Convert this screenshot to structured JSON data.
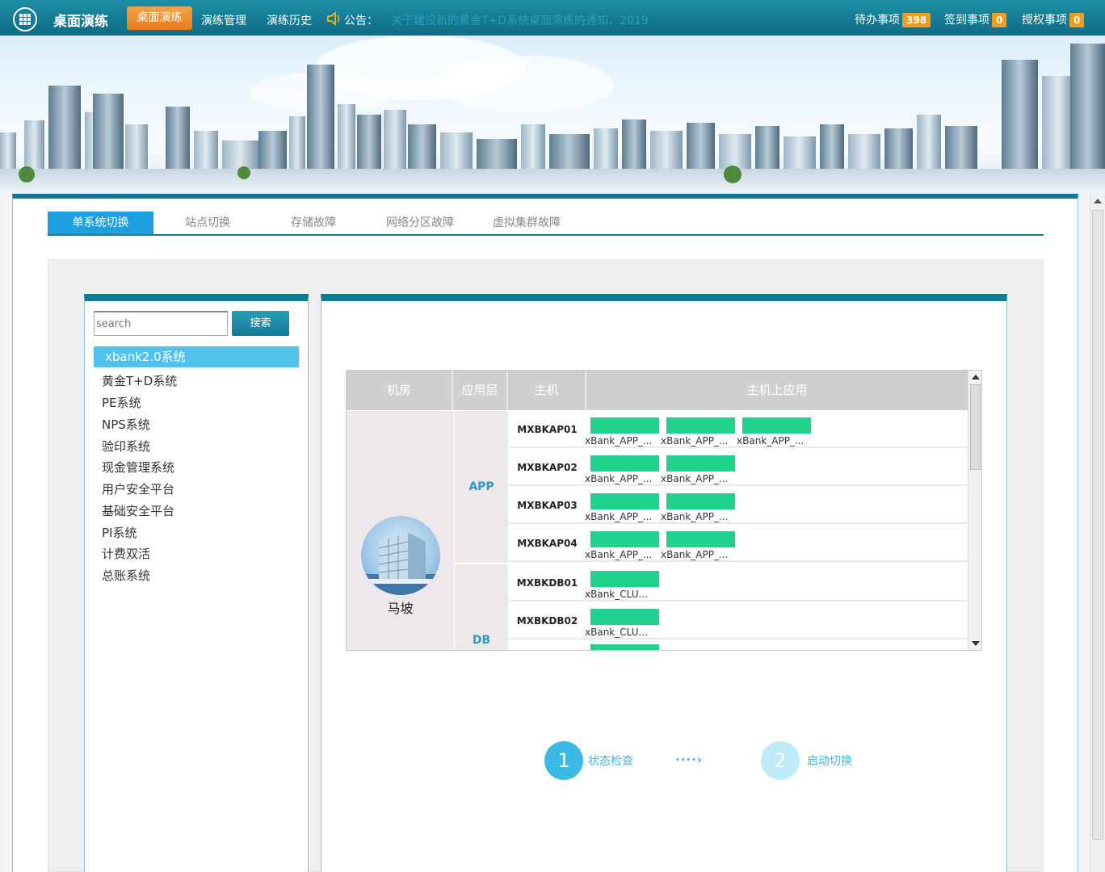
{
  "header": {
    "app_title": "桌面演练",
    "nav": [
      {
        "label": "桌面演练",
        "active": true
      },
      {
        "label": "演练管理"
      },
      {
        "label": "演练历史"
      }
    ],
    "notice_label": "公告：",
    "notice_text": "关于建设新的黄金T+D系统桌面演练的通知，2019",
    "todos": [
      {
        "label": "待办事项",
        "count": "398"
      },
      {
        "label": "签到事项",
        "count": "0"
      },
      {
        "label": "授权事项",
        "count": "0"
      }
    ],
    "colors": {
      "bar": "#137a93",
      "active_nav": "#e88a2a",
      "badge": "#f29b1f"
    }
  },
  "tabs": [
    {
      "label": "单系统切换",
      "active": true
    },
    {
      "label": "站点切换"
    },
    {
      "label": "存储故障"
    },
    {
      "label": "网络分区故障"
    },
    {
      "label": "虚拟集群故障"
    }
  ],
  "search": {
    "placeholder": "search",
    "button": "搜索"
  },
  "systems": [
    {
      "label": "xbank2.0系统",
      "selected": true
    },
    {
      "label": "黄金T+D系统"
    },
    {
      "label": "PE系统"
    },
    {
      "label": "NPS系统"
    },
    {
      "label": "验印系统"
    },
    {
      "label": "现金管理系统"
    },
    {
      "label": "用户安全平台"
    },
    {
      "label": "基础安全平台"
    },
    {
      "label": "PI系统"
    },
    {
      "label": "计费双活"
    },
    {
      "label": "总账系统"
    }
  ],
  "table": {
    "headers": [
      "机房",
      "应用层",
      "主机",
      "主机上应用"
    ],
    "room": "马坡",
    "layers": [
      "APP",
      "DB"
    ],
    "hosts": [
      {
        "name": "MXBKAP01",
        "apps": [
          "xBank_APP_...",
          "xBank_APP_...",
          "xBank_APP_..."
        ]
      },
      {
        "name": "MXBKAP02",
        "apps": [
          "xBank_APP_...",
          "xBank_APP_..."
        ]
      },
      {
        "name": "MXBKAP03",
        "apps": [
          "xBank_APP_...",
          "xBank_APP_..."
        ]
      },
      {
        "name": "MXBKAP04",
        "apps": [
          "xBank_APP_...",
          "xBank_APP_..."
        ]
      },
      {
        "name": "MXBKDB01",
        "apps": [
          "xBank_CLU..."
        ]
      },
      {
        "name": "MXBKDB02",
        "apps": [
          "xBank_CLU..."
        ]
      }
    ],
    "status_color": "#21d28f"
  },
  "steps": [
    {
      "num": "1",
      "label": "状态检查",
      "color": "#3ab8e6"
    },
    {
      "num": "2",
      "label": "启动切换",
      "color": "#bfeaf9"
    }
  ],
  "step_arrow": "····›"
}
